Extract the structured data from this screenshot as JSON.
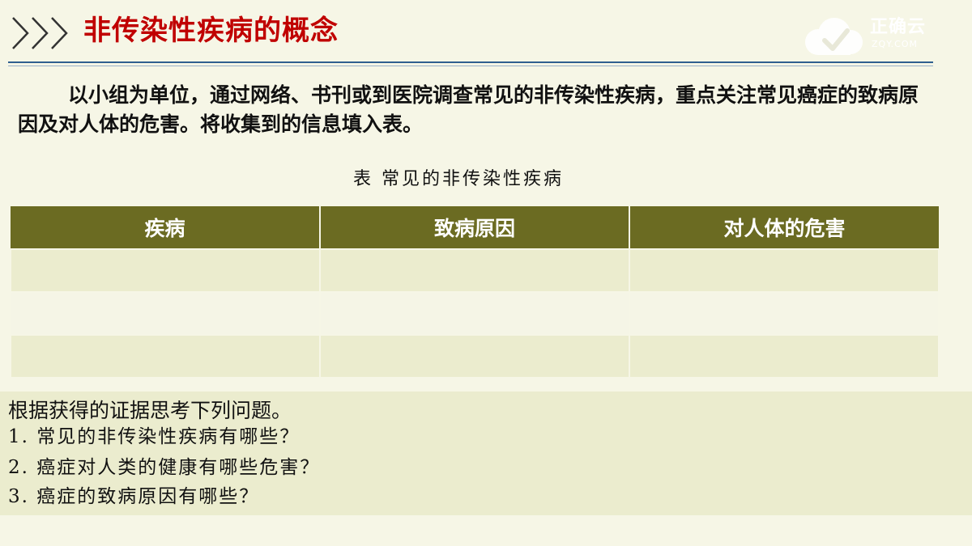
{
  "header": {
    "title": "非传染性疾病的概念",
    "logo_text": "正确云",
    "logo_subtext": "ZQY.COM"
  },
  "intro": "以小组为单位，通过网络、书刊或到医院调查常见的非传染性疾病，重点关注常见癌症的致病原因及对人体的危害。将收集到的信息填入表。",
  "table": {
    "caption": "表  常见的非传染性疾病",
    "columns": [
      "疾病",
      "致病原因",
      "对人体的危害"
    ],
    "rows": [
      [
        "",
        "",
        ""
      ],
      [
        "",
        "",
        ""
      ],
      [
        "",
        "",
        ""
      ]
    ]
  },
  "questions": {
    "title": "根据获得的证据思考下列问题。",
    "items": [
      "1. 常见的非传染性疾病有哪些？",
      "2. 癌症对人类的健康有哪些危害？",
      "3. 癌症的致病原因有哪些？"
    ]
  },
  "colors": {
    "title": "#c00000",
    "table_header": "#6b6b22",
    "row_alt": "#ebecce",
    "background": "#f6f6e6"
  },
  "icons": [
    "chevrons-icon",
    "cloud-check-logo"
  ]
}
